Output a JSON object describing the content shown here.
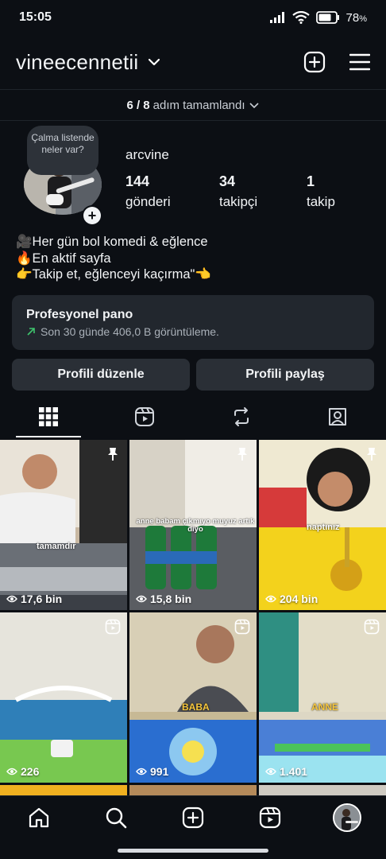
{
  "status_bar": {
    "time": "15:05",
    "battery": "78"
  },
  "header": {
    "username": "vineecennetii"
  },
  "steps": {
    "count": "6 / 8",
    "text": "adım tamamlandı"
  },
  "profile": {
    "note_bubble": "Çalma listende neler var?",
    "display_name": "arcvine",
    "stats": [
      {
        "value": "144",
        "label": "gönderi"
      },
      {
        "value": "34",
        "label": "takipçi"
      },
      {
        "value": "1",
        "label": "takip"
      }
    ],
    "bio": [
      "🎥Her gün bol komedi & eğlence",
      "🔥En aktif sayfa",
      "👉Takip et, eğlenceyi kaçırma\"👈"
    ]
  },
  "dashboard": {
    "title": "Profesyonel pano",
    "subtitle": "Son 30 günde 406,0 B görüntüleme."
  },
  "buttons": {
    "edit": "Profili düzenle",
    "share": "Profili paylaş"
  },
  "tabs": [
    "grid-icon",
    "reels-icon",
    "reposts-icon",
    "tagged-icon"
  ],
  "grid": [
    {
      "views": "17,6 bin",
      "badge": "pin",
      "caption": "tamamdır"
    },
    {
      "views": "15,8 bin",
      "badge": "pin",
      "caption": "anne babam çıkmıyo muyuz artık diyo"
    },
    {
      "views": "204 bin",
      "badge": "pin",
      "caption": "naptınız"
    },
    {
      "views": "226",
      "badge": "reel",
      "caption": ""
    },
    {
      "views": "991",
      "badge": "reel",
      "caption": "BABA"
    },
    {
      "views": "1.401",
      "badge": "reel",
      "caption": "ANNE"
    }
  ],
  "colors": {
    "background": "#0c0f14",
    "card": "#22272e",
    "button": "#2a2f36",
    "trend": "#3ec46d"
  }
}
